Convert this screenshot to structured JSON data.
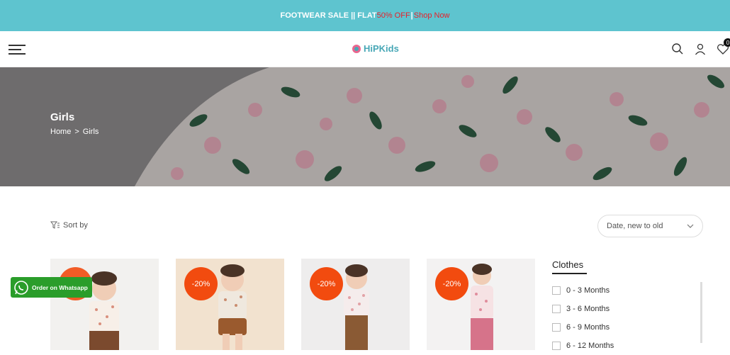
{
  "promo": {
    "text": "FOOTWEAR SALE || FLAT ",
    "discount": "50% OFF",
    "sep": "|",
    "link": "Shop Now"
  },
  "header": {
    "logo": "HiPKids",
    "cart_count": "0"
  },
  "banner": {
    "title": "Girls",
    "breadcrumb": [
      "Home",
      ">",
      "Girls"
    ]
  },
  "toolbar": {
    "sort_label": "Sort by",
    "sort_value": "Date, new to old"
  },
  "products": [
    {
      "discount": ""
    },
    {
      "discount": "-20%"
    },
    {
      "discount": "-20%"
    },
    {
      "discount": "-20%"
    }
  ],
  "whatsapp": {
    "label": "Order on Whatsapp"
  },
  "filters": {
    "title": "Clothes",
    "options": [
      "0 - 3 Months",
      "3 - 6 Months",
      "6 - 9 Months",
      "6 - 12 Months"
    ]
  }
}
